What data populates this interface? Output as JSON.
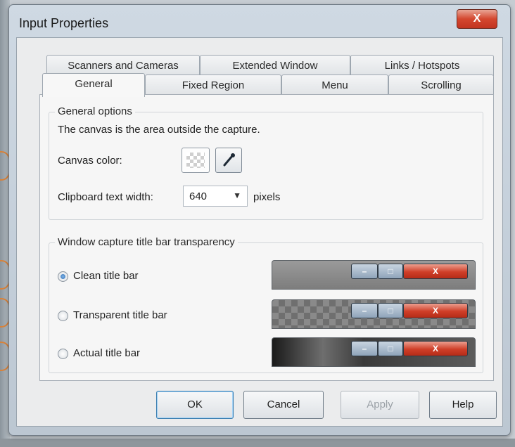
{
  "window": {
    "title": "Input Properties",
    "close_glyph": "X"
  },
  "tabs": {
    "row1": [
      "Scanners and Cameras",
      "Extended Window",
      "Links / Hotspots"
    ],
    "row2": [
      "General",
      "Fixed Region",
      "Menu",
      "Scrolling"
    ],
    "active": "General"
  },
  "general_options": {
    "heading": "General options",
    "description": "The canvas is the area outside the capture.",
    "canvas_color_label": "Canvas color:",
    "clipboard_width_label": "Clipboard text width:",
    "clipboard_width_value": "640",
    "units": "pixels"
  },
  "transparency": {
    "heading": "Window capture title bar transparency",
    "options": [
      {
        "label": "Clean title bar",
        "checked": true
      },
      {
        "label": "Transparent title bar",
        "checked": false
      },
      {
        "label": "Actual title bar",
        "checked": false
      }
    ],
    "preview_close_glyph": "X",
    "preview_min_glyph": "–",
    "preview_max_glyph": "□"
  },
  "buttons": {
    "ok": "OK",
    "cancel": "Cancel",
    "apply": "Apply",
    "help": "Help"
  },
  "icons": [
    "close-icon",
    "eyedropper-icon",
    "dropdown-arrow-icon"
  ],
  "colors": {
    "accent": "#3c7fb1",
    "close_red": "#cf3e28",
    "callout": "#d8823a"
  }
}
